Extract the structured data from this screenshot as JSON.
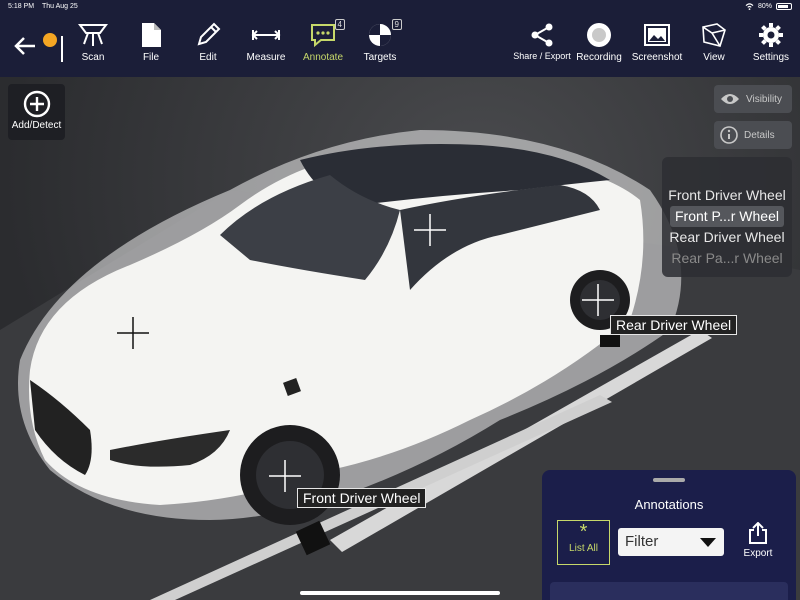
{
  "status_bar": {
    "time": "5:18 PM",
    "date": "Thu Aug 25",
    "battery": "80%"
  },
  "toolbar": {
    "items": [
      {
        "label": "Scan",
        "icon": "scan-icon"
      },
      {
        "label": "File",
        "icon": "file-icon"
      },
      {
        "label": "Edit",
        "icon": "pencil-icon"
      },
      {
        "label": "Measure",
        "icon": "measure-icon"
      },
      {
        "label": "Annotate",
        "icon": "annotate-icon",
        "badge": "4",
        "active": true
      },
      {
        "label": "Targets",
        "icon": "target-icon",
        "badge": "9"
      },
      {
        "label": "Share / Export",
        "icon": "share-icon"
      },
      {
        "label": "Recording",
        "icon": "record-icon"
      },
      {
        "label": "Screenshot",
        "icon": "screenshot-icon"
      },
      {
        "label": "View",
        "icon": "cube-icon"
      },
      {
        "label": "Settings",
        "icon": "gear-icon"
      }
    ],
    "active_color": "#c6d86a"
  },
  "add_detect": {
    "label": "Add/Detect"
  },
  "visibility": {
    "label": "Visibility"
  },
  "details": {
    "label": "Details"
  },
  "annotation_list": {
    "items": [
      {
        "label": "Front Driver Wheel"
      },
      {
        "label": "Front P...r Wheel",
        "selected": true
      },
      {
        "label": "Rear Driver Wheel"
      },
      {
        "label": "Rear Pa...r Wheel"
      }
    ]
  },
  "scene_tags": {
    "rear_driver": "Rear Driver Wheel",
    "front_driver": "Front Driver Wheel"
  },
  "annotations_panel": {
    "title": "Annotations",
    "list_all": "List All",
    "filter": "Filter",
    "export": "Export"
  },
  "colors": {
    "toolbar_bg": "#1b1e38",
    "panel_bg": "#1b1e4a",
    "accent": "#c6d86a",
    "notification": "#f5a623"
  }
}
